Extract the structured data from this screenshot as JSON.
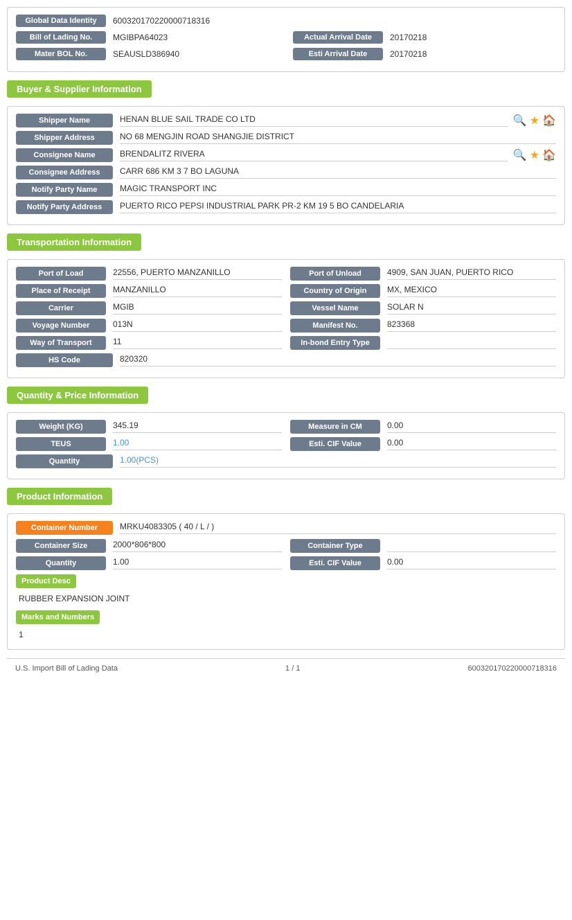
{
  "identity": {
    "global_label": "Global Data Identity",
    "global_value": "600320170220000718316",
    "bol_label": "Bill of Lading No.",
    "bol_value": "MGIBPA64023",
    "actual_arrival_label": "Actual Arrival Date",
    "actual_arrival_value": "20170218",
    "mater_bol_label": "Mater BOL No.",
    "mater_bol_value": "SEAUSLD386940",
    "esti_arrival_label": "Esti Arrival Date",
    "esti_arrival_value": "20170218"
  },
  "buyer_supplier": {
    "section_title": "Buyer & Supplier Information",
    "shipper_name_label": "Shipper Name",
    "shipper_name_value": "HENAN BLUE SAIL TRADE CO LTD",
    "shipper_address_label": "Shipper Address",
    "shipper_address_value": "NO 68 MENGJIN ROAD SHANGJIE DISTRICT",
    "consignee_name_label": "Consignee Name",
    "consignee_name_value": "BRENDALITZ RIVERA",
    "consignee_address_label": "Consignee Address",
    "consignee_address_value": "CARR 686 KM 3 7 BO LAGUNA",
    "notify_party_name_label": "Notify Party Name",
    "notify_party_name_value": "MAGIC TRANSPORT INC",
    "notify_party_address_label": "Notify Party Address",
    "notify_party_address_value": "PUERTO RICO PEPSI INDUSTRIAL PARK PR-2 KM 19 5 BO CANDELARIA"
  },
  "transportation": {
    "section_title": "Transportation Information",
    "port_of_load_label": "Port of Load",
    "port_of_load_value": "22556, PUERTO MANZANILLO",
    "port_of_unload_label": "Port of Unload",
    "port_of_unload_value": "4909, SAN JUAN, PUERTO RICO",
    "place_of_receipt_label": "Place of Receipt",
    "place_of_receipt_value": "MANZANILLO",
    "country_of_origin_label": "Country of Origin",
    "country_of_origin_value": "MX, MEXICO",
    "carrier_label": "Carrier",
    "carrier_value": "MGIB",
    "vessel_name_label": "Vessel Name",
    "vessel_name_value": "SOLAR N",
    "voyage_number_label": "Voyage Number",
    "voyage_number_value": "013N",
    "manifest_no_label": "Manifest No.",
    "manifest_no_value": "823368",
    "way_of_transport_label": "Way of Transport",
    "way_of_transport_value": "11",
    "inbond_entry_label": "In-bond Entry Type",
    "inbond_entry_value": "",
    "hs_code_label": "HS Code",
    "hs_code_value": "820320"
  },
  "quantity_price": {
    "section_title": "Quantity & Price Information",
    "weight_label": "Weight (KG)",
    "weight_value": "345.19",
    "measure_label": "Measure in CM",
    "measure_value": "0.00",
    "teus_label": "TEUS",
    "teus_value": "1.00",
    "esti_cif_label": "Esti. CIF Value",
    "esti_cif_value": "0.00",
    "quantity_label": "Quantity",
    "quantity_value": "1.00(PCS)"
  },
  "product": {
    "section_title": "Product Information",
    "container_number_label": "Container Number",
    "container_number_value": "MRKU4083305 ( 40 / L / )",
    "container_size_label": "Container Size",
    "container_size_value": "2000*806*800",
    "container_type_label": "Container Type",
    "container_type_value": "",
    "quantity_label": "Quantity",
    "quantity_value": "1.00",
    "esti_cif_label": "Esti. CIF Value",
    "esti_cif_value": "0.00",
    "product_desc_label": "Product Desc",
    "product_desc_value": "RUBBER EXPANSION JOINT",
    "marks_numbers_label": "Marks and Numbers",
    "marks_numbers_value": "1"
  },
  "footer": {
    "left": "U.S. Import Bill of Lading Data",
    "center": "1 / 1",
    "right": "600320170220000718316"
  }
}
